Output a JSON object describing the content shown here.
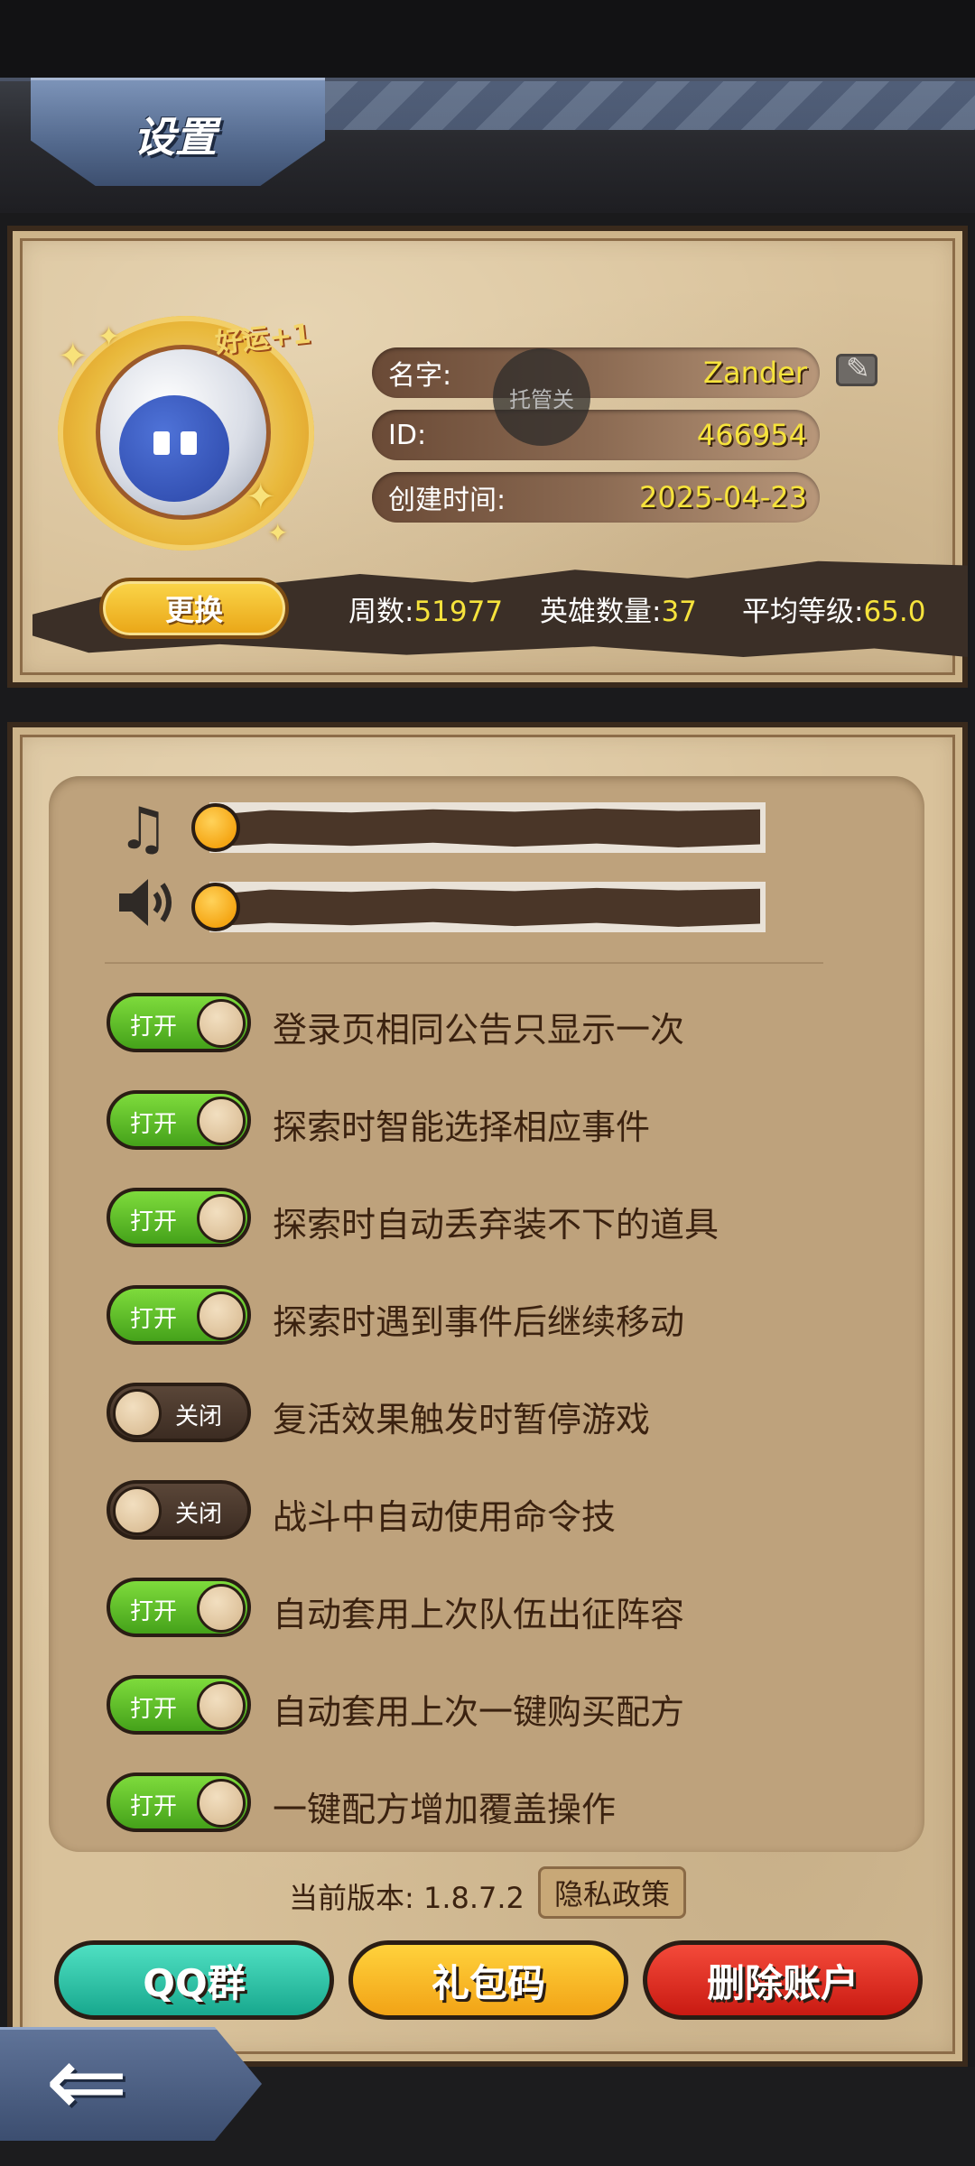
{
  "header": {
    "title": "设置"
  },
  "profile": {
    "badge": "好运+1",
    "rows": [
      {
        "label": "名字:",
        "value": "Zander"
      },
      {
        "label": "ID:",
        "value": "466954"
      },
      {
        "label": "创建时间:",
        "value": "2025-04-23"
      }
    ],
    "overlay_text": "托管关",
    "change_label": "更换",
    "stats": [
      {
        "label": "周数:",
        "value": "51977"
      },
      {
        "label": "英雄数量:",
        "value": "37"
      },
      {
        "label": "平均等级:",
        "value": "65.0"
      }
    ]
  },
  "audio": {
    "music_icon": "music-note-icon",
    "sound_icon": "speaker-icon",
    "music_level": 0,
    "sound_level": 0
  },
  "options": [
    {
      "state": "on",
      "toggle_label": "打开",
      "label": "登录页相同公告只显示一次"
    },
    {
      "state": "on",
      "toggle_label": "打开",
      "label": "探索时智能选择相应事件"
    },
    {
      "state": "on",
      "toggle_label": "打开",
      "label": "探索时自动丢弃装不下的道具"
    },
    {
      "state": "on",
      "toggle_label": "打开",
      "label": "探索时遇到事件后继续移动"
    },
    {
      "state": "off",
      "toggle_label": "关闭",
      "label": "复活效果触发时暂停游戏"
    },
    {
      "state": "off",
      "toggle_label": "关闭",
      "label": "战斗中自动使用命令技"
    },
    {
      "state": "on",
      "toggle_label": "打开",
      "label": "自动套用上次队伍出征阵容"
    },
    {
      "state": "on",
      "toggle_label": "打开",
      "label": "自动套用上次一键购买配方"
    },
    {
      "state": "on",
      "toggle_label": "打开",
      "label": "一键配方增加覆盖操作"
    }
  ],
  "footer": {
    "version": "当前版本: 1.8.7.2",
    "privacy": "隐私政策",
    "qq_group": "QQ群",
    "gift_code": "礼包码",
    "delete_account": "删除账户"
  },
  "colors": {
    "parchment": "#d9c29b",
    "toggle_on": "#5cc126",
    "toggle_off": "#4a3628",
    "value_yellow": "#f6e33c",
    "qq_teal": "#2bc2a6",
    "gift_yellow": "#f5b41e",
    "delete_red": "#e02a1e"
  }
}
